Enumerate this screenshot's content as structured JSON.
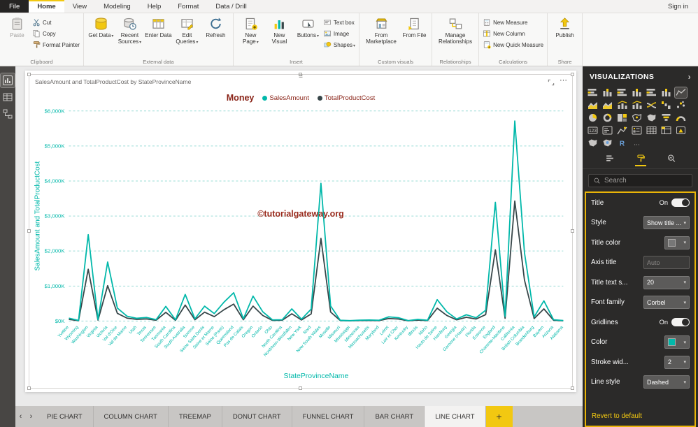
{
  "app": {
    "signin_label": "Sign in"
  },
  "menubar": {
    "file_label": "File",
    "tabs": [
      "Home",
      "View",
      "Modeling",
      "Help",
      "Format",
      "Data / Drill"
    ],
    "active_tab": "Home"
  },
  "ribbon": {
    "groups": [
      {
        "label": "Clipboard",
        "buttons": [
          {
            "label": "Paste",
            "icon": "paste"
          },
          {
            "label": "Cut",
            "icon": "cut"
          },
          {
            "label": "Copy",
            "icon": "copy"
          },
          {
            "label": "Format Painter",
            "icon": "format-painter"
          }
        ]
      },
      {
        "label": "External data",
        "buttons": [
          {
            "label": "Get Data",
            "icon": "get-data"
          },
          {
            "label": "Recent Sources",
            "icon": "recent-sources"
          },
          {
            "label": "Enter Data",
            "icon": "enter-data"
          },
          {
            "label": "Edit Queries",
            "icon": "edit-queries"
          },
          {
            "label": "Refresh",
            "icon": "refresh"
          }
        ]
      },
      {
        "label": "Insert",
        "buttons": [
          {
            "label": "New Page",
            "icon": "new-page"
          },
          {
            "label": "New Visual",
            "icon": "new-visual"
          },
          {
            "label": "Buttons",
            "icon": "buttons"
          },
          {
            "label": "Text box",
            "icon": "text-box"
          },
          {
            "label": "Image",
            "icon": "image"
          },
          {
            "label": "Shapes",
            "icon": "shapes"
          }
        ]
      },
      {
        "label": "Custom visuals",
        "buttons": [
          {
            "label": "From Marketplace",
            "icon": "from-marketplace"
          },
          {
            "label": "From File",
            "icon": "from-file"
          }
        ]
      },
      {
        "label": "Relationships",
        "buttons": [
          {
            "label": "Manage Relationships",
            "icon": "manage-relationships"
          }
        ]
      },
      {
        "label": "Calculations",
        "buttons": [
          {
            "label": "New Measure",
            "icon": "new-measure"
          },
          {
            "label": "New Column",
            "icon": "new-column"
          },
          {
            "label": "New Quick Measure",
            "icon": "new-quick-measure"
          }
        ]
      },
      {
        "label": "Share",
        "buttons": [
          {
            "label": "Publish",
            "icon": "publish"
          }
        ]
      }
    ]
  },
  "visual": {
    "title": "SalesAmount and TotalProductCost by StateProvinceName"
  },
  "chart_data": {
    "type": "line",
    "title": "Money",
    "xlabel": "StateProvinceName",
    "ylabel": "SalesAmount and TotalProductCost",
    "ylim": [
      0,
      6000
    ],
    "ytick_labels": [
      "$0K",
      "$1,000K",
      "$2,000K",
      "$3,000K",
      "$4,000K",
      "$5,000K",
      "$6,000K"
    ],
    "ytick_values": [
      0,
      1000,
      2000,
      3000,
      4000,
      5000,
      6000
    ],
    "legend_position": "top-center",
    "gridlines": "dashed",
    "gridline_color": "#9adcd6",
    "axis_color": "#01b8aa",
    "watermark": "©tutorialgateway.org",
    "categories": [
      "Yveline",
      "Wyoming",
      "Washington",
      "Virginia",
      "Victoria",
      "Val d'Oise",
      "Val de Marne",
      "Utah",
      "Texas",
      "Tennessee",
      "Tasmania",
      "South Carolina",
      "South Australia",
      "Somme",
      "Seine Saint Denis",
      "Seine et Marne",
      "Seine (Paris)",
      "Queensland",
      "Pas de Calais",
      "Oregon",
      "Ontario",
      "Ohio",
      "North Carolina",
      "Nordrhein-Westfalen",
      "New York",
      "Nord",
      "New South Wales",
      "Moselle",
      "Missouri",
      "Mississippi",
      "Minnesota",
      "Massachusetts",
      "Maryland",
      "Loiret",
      "Loir et Cher",
      "Kentucky",
      "Illinois",
      "Idaho",
      "Hauts de Seine",
      "Hamburg",
      "Georgia",
      "Garonne (Haute)",
      "Florida",
      "Essonne",
      "England",
      "Charente-Maritime",
      "California",
      "British Columbia",
      "Brandenburg",
      "Bayern",
      "Arizona",
      "Alabama"
    ],
    "series": [
      {
        "name": "SalesAmount",
        "color": "#01b8aa",
        "values": [
          84,
          18,
          2467,
          41,
          1687,
          371,
          139,
          79,
          103,
          40,
          419,
          36,
          761,
          64,
          425,
          214,
          539,
          809,
          64,
          714,
          266,
          34,
          38,
          347,
          54,
          343,
          3934,
          430,
          22,
          12,
          26,
          31,
          24,
          121,
          96,
          14,
          47,
          23,
          611,
          264,
          59,
          180,
          95,
          307,
          3391,
          132,
          5714,
          1955,
          119,
          579,
          38,
          16
        ]
      },
      {
        "name": "TotalProductCost",
        "color": "#374649",
        "values": [
          49,
          11,
          1480,
          25,
          1012,
          223,
          83,
          47,
          62,
          24,
          251,
          22,
          457,
          38,
          255,
          128,
          323,
          485,
          38,
          428,
          160,
          20,
          23,
          208,
          32,
          206,
          2360,
          258,
          13,
          7,
          16,
          19,
          14,
          73,
          58,
          8,
          28,
          14,
          367,
          158,
          35,
          108,
          57,
          184,
          2035,
          79,
          3428,
          1173,
          71,
          347,
          23,
          10
        ]
      }
    ]
  },
  "visualizations_pane": {
    "title": "VISUALIZATIONS",
    "selected_icon": "line-chart",
    "icons": [
      "stacked-bar-chart",
      "stacked-column-chart",
      "clustered-bar-chart",
      "clustered-column-chart",
      "100-stacked-bar-chart",
      "100-stacked-column-chart",
      "line-chart",
      "area-chart",
      "stacked-area-chart",
      "line-and-clustered-column-chart",
      "line-and-stacked-column-chart",
      "ribbon-chart",
      "waterfall-chart",
      "scatter-chart",
      "pie-chart",
      "donut-chart",
      "treemap",
      "map",
      "filled-map",
      "funnel",
      "gauge",
      "card",
      "multi-row-card",
      "kpi",
      "slicer",
      "table",
      "matrix",
      "powerapps-visual",
      "shape-map",
      "arcgis-map",
      "r-script-visual",
      "more-options"
    ],
    "tabs": [
      "fields",
      "format",
      "analytics"
    ],
    "active_tab": "format",
    "search_placeholder": "Search"
  },
  "format_pane": {
    "rows": [
      {
        "label": "Title",
        "control": "toggle",
        "value": "On"
      },
      {
        "label": "Style",
        "control": "dropdown",
        "value": "Show title ..."
      },
      {
        "label": "Title color",
        "control": "color",
        "swatch": "#777777"
      },
      {
        "label": "Axis title",
        "control": "input",
        "value": "Auto"
      },
      {
        "label": "Title text s...",
        "control": "input",
        "value": "20"
      },
      {
        "label": "Font family",
        "control": "dropdown",
        "value": "Corbel"
      },
      {
        "label": "Gridlines",
        "control": "toggle",
        "value": "On"
      },
      {
        "label": "Color",
        "control": "color",
        "swatch": "#01b8aa"
      },
      {
        "label": "Stroke wid...",
        "control": "dropdown",
        "value": "2"
      },
      {
        "label": "Line style",
        "control": "dropdown",
        "value": "Dashed"
      }
    ],
    "revert_label": "Revert to default"
  },
  "pages": {
    "tabs": [
      "PIE CHART",
      "COLUMN CHART",
      "TREEMAP",
      "DONUT CHART",
      "FUNNEL CHART",
      "BAR CHART",
      "LINE CHART"
    ],
    "active_index": 6,
    "add_label": "+"
  }
}
